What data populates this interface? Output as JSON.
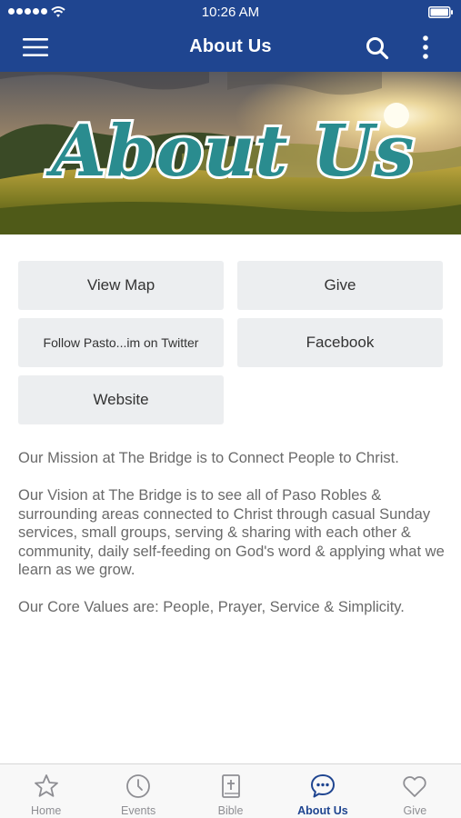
{
  "status_bar": {
    "time": "10:26 AM"
  },
  "nav": {
    "title": "About Us",
    "menu_icon": "hamburger-menu-icon",
    "search_icon": "search-icon",
    "more_icon": "more-vertical-icon"
  },
  "banner": {
    "title": "About Us"
  },
  "buttons": [
    {
      "label": "View Map"
    },
    {
      "label": "Give"
    },
    {
      "label": "Follow Pasto...im on Twitter"
    },
    {
      "label": "Facebook"
    },
    {
      "label": "Website"
    }
  ],
  "content": {
    "mission": "Our Mission at The Bridge is to Connect People to Christ.",
    "vision": "Our Vision at The Bridge is to see all of Paso Robles & surrounding areas connected to Christ through casual Sunday services, small groups, serving & sharing with each other & community, daily self-feeding on God's word & applying what we learn as we grow.",
    "values": "Our Core Values are: People, Prayer, Service & Simplicity."
  },
  "tabs": [
    {
      "label": "Home",
      "icon": "star-icon",
      "active": false
    },
    {
      "label": "Events",
      "icon": "clock-icon",
      "active": false
    },
    {
      "label": "Bible",
      "icon": "bible-icon",
      "active": false
    },
    {
      "label": "About Us",
      "icon": "chat-bubble-icon",
      "active": true
    },
    {
      "label": "Give",
      "icon": "heart-icon",
      "active": false
    }
  ],
  "colors": {
    "brand": "#1f4590",
    "button_bg": "#eceef0",
    "text": "#6a6a6a",
    "banner_title": "#2a8c8f"
  }
}
